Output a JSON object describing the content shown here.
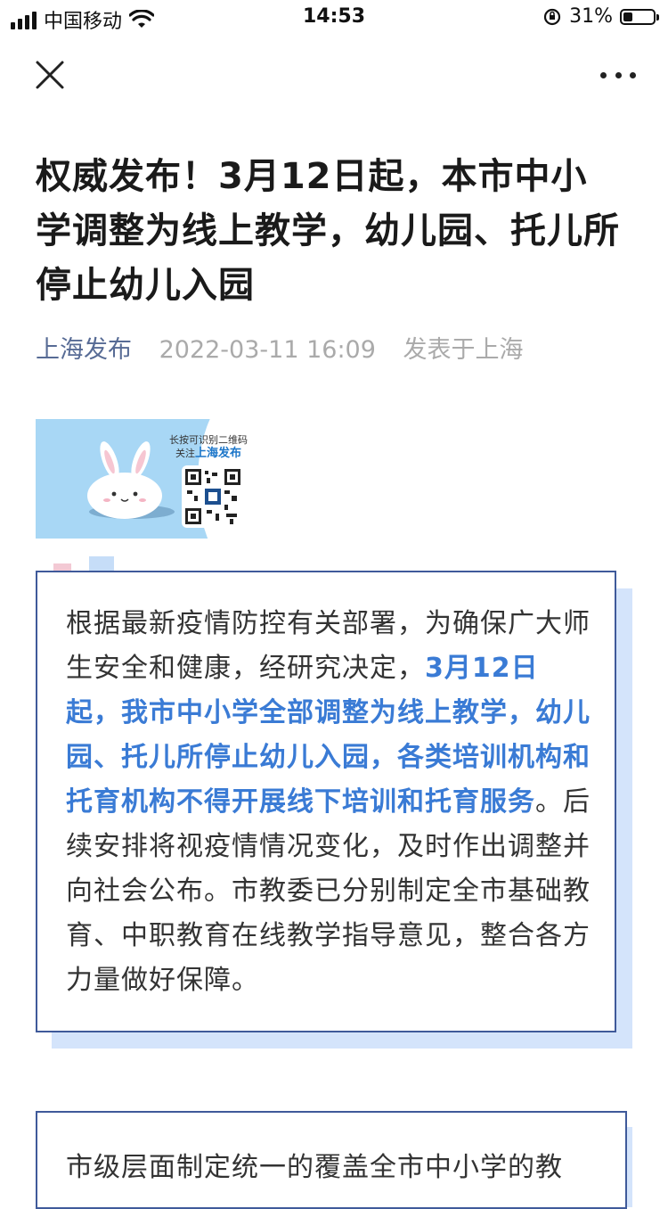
{
  "status_bar": {
    "carrier": "中国移动",
    "time": "14:53",
    "battery": "31%",
    "battery_level": 0.31
  },
  "nav": {
    "close_icon": "close-icon",
    "more_icon": "more-dots-icon"
  },
  "article": {
    "title": "权威发布！3月12日起，本市中小学调整为线上教学，幼儿园、托儿所停止幼儿入园",
    "author": "上海发布",
    "date": "2022-03-11 16:09",
    "location": "发表于上海"
  },
  "banner": {
    "caption_line1": "长按可识别二维码",
    "caption_line2_prefix": "关注",
    "caption_line2_brand": "上海发布"
  },
  "card1": {
    "text_before": "根据最新疫情防控有关部署，为确保广大师生安全和健康，经研究决定，",
    "text_highlight": "3月12日起，我市中小学全部调整为线上教学，幼儿园、托儿所停止幼儿入园，各类培训机构和托育机构不得开展线下培训和托育服务",
    "text_after": "。后续安排将视疫情情况变化，及时作出调整并向社会公布。市教委已分别制定全市基础教育、中职教育在线教学指导意见，整合各方力量做好保障。"
  },
  "card2": {
    "text": "市级层面制定统一的覆盖全市中小学的教"
  },
  "colors": {
    "author_link": "#576b95",
    "highlight": "#3a7bd5",
    "card_border": "#3f5a9a",
    "card_shadow": "#d4e4fb"
  }
}
